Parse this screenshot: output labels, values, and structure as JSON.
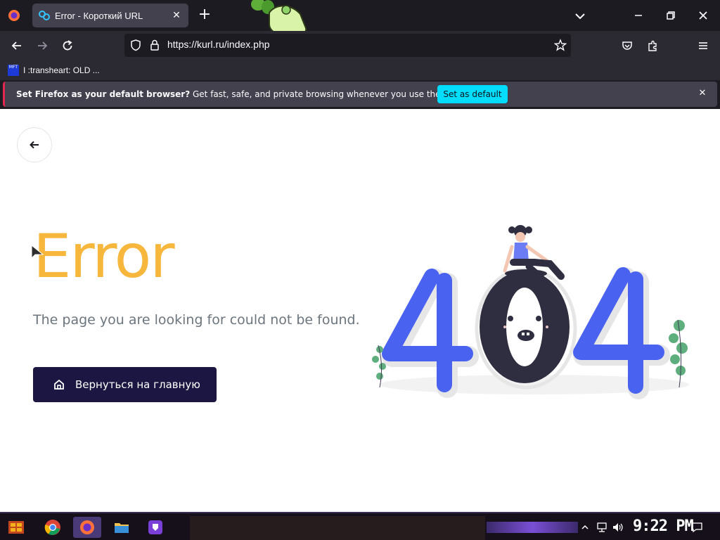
{
  "browser": {
    "tab": {
      "title": "Error - Короткий URL"
    },
    "url": "https://kurl.ru/index.php",
    "bookmark": {
      "label": "I :transheart: OLD ...",
      "icon_text": "MFT"
    },
    "notification": {
      "bold_text": "Set Firefox as your default browser?",
      "text": " Get fast, safe, and private browsing whenever you use the web.",
      "button_label": "Set as default"
    },
    "accent_color": "#00ddff"
  },
  "page": {
    "heading": "Error",
    "subtitle": "The page you are looking for could not be found.",
    "home_button_label": "Вернуться на главную",
    "illustration_text": "404",
    "heading_color": "#f6b73c",
    "button_color": "#1b1742"
  },
  "taskbar": {
    "clock": "9:22 PM",
    "icons": [
      "start-icon",
      "chrome-icon",
      "firefox-icon",
      "file-explorer-icon",
      "app-shield-icon"
    ]
  }
}
